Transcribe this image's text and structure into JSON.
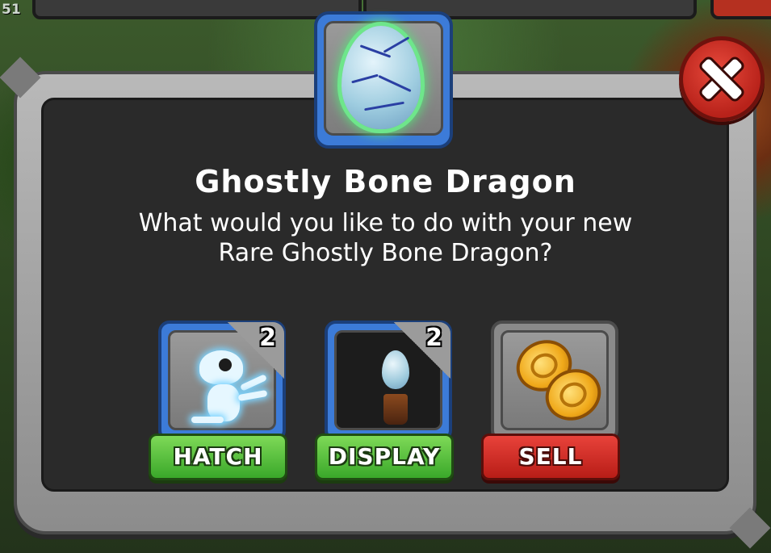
{
  "status": {
    "corner_number": "51"
  },
  "dialog": {
    "title": "Ghostly Bone Dragon",
    "message_line1": "What would you like to do with your new",
    "message_line2": "Rare Ghostly Bone Dragon?",
    "close_icon": "close-x-icon"
  },
  "options": [
    {
      "label": "HATCH",
      "count": "2",
      "icon": "ghost-dragon-icon",
      "button_color": "#4bbf33"
    },
    {
      "label": "DISPLAY",
      "count": "2",
      "icon": "egg-on-pedestal-icon",
      "button_color": "#4bbf33"
    },
    {
      "label": "SELL",
      "count": "",
      "icon": "gold-coins-icon",
      "button_color": "#d3302a"
    }
  ],
  "colors": {
    "accent_blue": "#3c7bd8",
    "frame_gray": "#9b9b9b",
    "panel_dark": "#2a2a2a",
    "egg_glow": "#5ae07a"
  }
}
